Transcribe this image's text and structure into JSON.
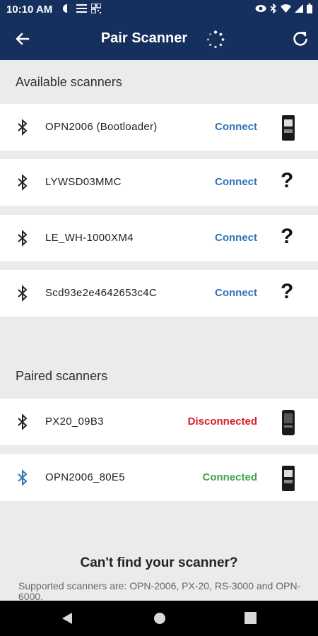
{
  "status_bar": {
    "time": "10:10 AM"
  },
  "app_bar": {
    "title": "Pair Scanner"
  },
  "available": {
    "heading": "Available scanners",
    "items": [
      {
        "name": "OPN2006 (Bootloader)",
        "action": "Connect",
        "icon": "scanner-thumbnail"
      },
      {
        "name": "LYWSD03MMC",
        "action": "Connect",
        "icon": "question-mark"
      },
      {
        "name": "LE_WH-1000XM4",
        "action": "Connect",
        "icon": "question-mark"
      },
      {
        "name": "Scd93e2e4642653c4C",
        "action": "Connect",
        "icon": "question-mark"
      }
    ]
  },
  "paired": {
    "heading": "Paired scanners",
    "items": [
      {
        "name": "PX20_09B3",
        "status": "Disconnected",
        "icon": "scanner-thumbnail"
      },
      {
        "name": "OPN2006_80E5",
        "status": "Connected",
        "icon": "scanner-thumbnail"
      }
    ]
  },
  "help": {
    "title": "Can't find your scanner?",
    "text": "Supported scanners are: OPN-2006, PX-20, RS-3000 and OPN-6000."
  },
  "colors": {
    "app_bar": "#16305e",
    "connect": "#2e74b5",
    "disconnected": "#d61f28",
    "connected": "#3fa54a",
    "bluetooth_active": "#2e74b5"
  }
}
